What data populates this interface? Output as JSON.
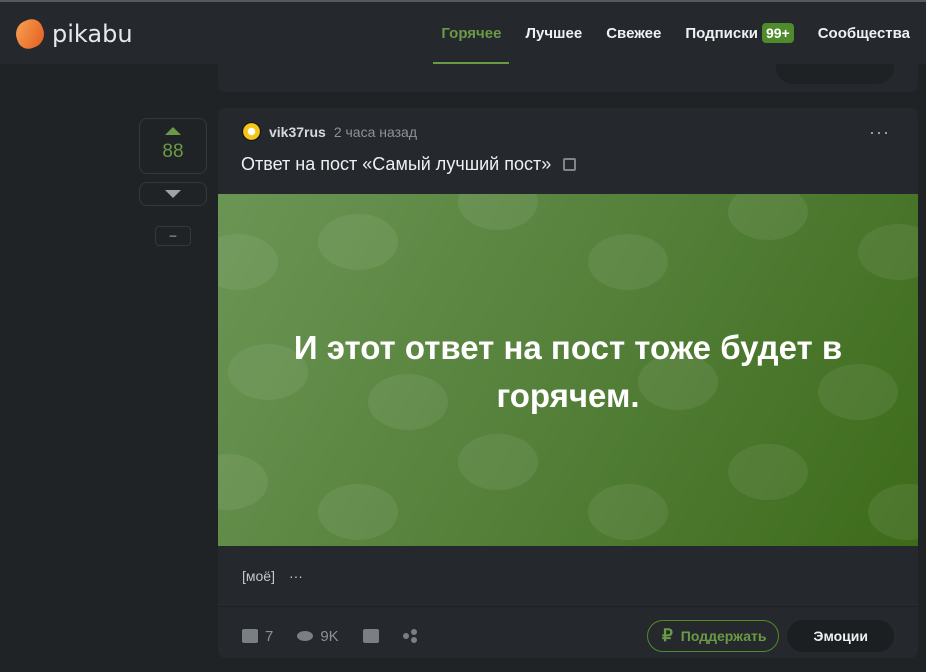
{
  "header": {
    "logo": "pikabu",
    "nav": [
      {
        "label": "Горячее",
        "active": true
      },
      {
        "label": "Лучшее"
      },
      {
        "label": "Свежее"
      },
      {
        "label": "Подписки",
        "badge": "99+"
      },
      {
        "label": "Сообщества"
      }
    ]
  },
  "vote": {
    "count": "88",
    "hide_label": "–"
  },
  "post": {
    "author": "vik37rus",
    "time": "2 часа назад",
    "title": "Ответ на пост «Самый лучший пост»",
    "image_text": "И этот ответ на пост тоже будет в горячем.",
    "tags": [
      "[моё]",
      "···"
    ],
    "comments": "7",
    "views": "9K",
    "support_label": "Поддержать",
    "emotions_label": "Эмоции",
    "more": "···"
  },
  "colors": {
    "accent": "#6a9a45",
    "background": "#202326",
    "card": "#25292d"
  }
}
